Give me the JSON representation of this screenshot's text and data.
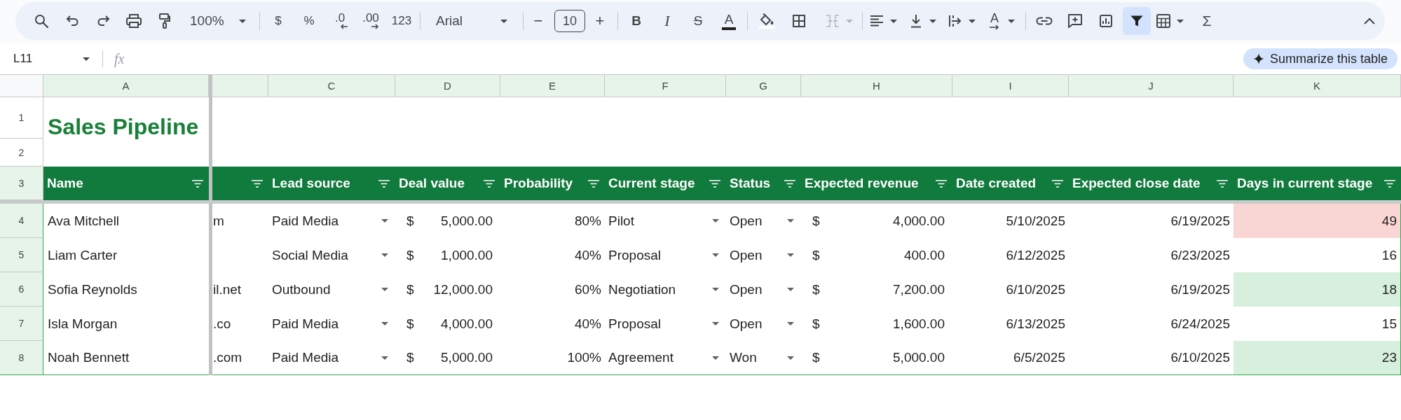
{
  "toolbar": {
    "zoom": "100%",
    "currency": "$",
    "percent": "%",
    "decrease_decimals": ".0",
    "increase_decimals": ".00",
    "number_format": "123",
    "font": "Arial",
    "decrease_font_size": "−",
    "font_size": "10",
    "increase_font_size": "+",
    "bold": "B",
    "italic": "I",
    "strikethrough": "S",
    "text_color": "A",
    "merge_cells": {
      "disabled": true
    },
    "text_rotation": "A",
    "filter": {
      "selected": true
    },
    "functions": "Σ"
  },
  "formula_bar": {
    "cell_reference": "L11",
    "function_label": "fx"
  },
  "summarize_button": {
    "label": "Summarize this table"
  },
  "sheet": {
    "columns": [
      {
        "letter": "A",
        "header": "Name",
        "kind": "text"
      },
      {
        "kind": "clipped"
      },
      {
        "letter": "C",
        "header": "Lead source",
        "kind": "dropdown"
      },
      {
        "letter": "D",
        "header": "Deal value",
        "kind": "currency"
      },
      {
        "letter": "E",
        "header": "Probability",
        "kind": "number"
      },
      {
        "letter": "F",
        "header": "Current stage",
        "kind": "dropdown"
      },
      {
        "letter": "G",
        "header": "Status",
        "kind": "dropdown"
      },
      {
        "letter": "H",
        "header": "Expected revenue",
        "kind": "currency"
      },
      {
        "letter": "I",
        "header": "Date created",
        "kind": "number"
      },
      {
        "letter": "J",
        "header": "Expected close date",
        "kind": "number"
      },
      {
        "letter": "K",
        "header": "Days in current stage",
        "kind": "number"
      }
    ],
    "row_numbers": [
      {
        "label": "1",
        "highlighted": false
      },
      {
        "label": "2",
        "highlighted": false
      },
      {
        "label": "3",
        "highlighted": true
      },
      {
        "label": "4",
        "highlighted": true
      },
      {
        "label": "5",
        "highlighted": true
      },
      {
        "label": "6",
        "highlighted": true
      },
      {
        "label": "7",
        "highlighted": true
      },
      {
        "label": "8",
        "highlighted": true
      }
    ],
    "title": "Sales Pipeline",
    "rows": [
      {
        "cells": [
          {
            "text": "Ava Mitchell"
          },
          {
            "text": "m"
          },
          {
            "text": "Paid Media"
          },
          {
            "currency": "$",
            "text": "5,000.00"
          },
          {
            "text": "80%"
          },
          {
            "text": "Pilot"
          },
          {
            "text": "Open"
          },
          {
            "currency": "$",
            "text": "4,000.00"
          },
          {
            "text": "5/10/2025"
          },
          {
            "text": "6/19/2025"
          },
          {
            "text": "49",
            "color": "#f9d6d3"
          }
        ]
      },
      {
        "cells": [
          {
            "text": "Liam Carter"
          },
          null,
          {
            "text": "Social Media"
          },
          {
            "currency": "$",
            "text": "1,000.00"
          },
          {
            "text": "40%"
          },
          {
            "text": "Proposal"
          },
          {
            "text": "Open"
          },
          {
            "currency": "$",
            "text": "400.00"
          },
          {
            "text": "6/12/2025"
          },
          {
            "text": "6/23/2025"
          },
          {
            "text": "16"
          }
        ]
      },
      {
        "cells": [
          {
            "text": "Sofia Reynolds"
          },
          {
            "text": "il.net"
          },
          {
            "text": "Outbound"
          },
          {
            "currency": "$",
            "text": "12,000.00"
          },
          {
            "text": "60%"
          },
          {
            "text": "Negotiation"
          },
          {
            "text": "Open"
          },
          {
            "currency": "$",
            "text": "7,200.00"
          },
          {
            "text": "6/10/2025"
          },
          {
            "text": "6/19/2025"
          },
          {
            "text": "18",
            "color": "#d6f0dd"
          }
        ]
      },
      {
        "cells": [
          {
            "text": "Isla Morgan"
          },
          {
            "text": ".co"
          },
          {
            "text": "Paid Media"
          },
          {
            "currency": "$",
            "text": "4,000.00"
          },
          {
            "text": "40%"
          },
          {
            "text": "Proposal"
          },
          {
            "text": "Open"
          },
          {
            "currency": "$",
            "text": "1,600.00"
          },
          {
            "text": "6/13/2025"
          },
          {
            "text": "6/24/2025"
          },
          {
            "text": "15"
          }
        ]
      },
      {
        "cells": [
          {
            "text": "Noah Bennett"
          },
          {
            "text": ".com"
          },
          {
            "text": "Paid Media"
          },
          {
            "currency": "$",
            "text": "5,000.00"
          },
          {
            "text": "100%"
          },
          {
            "text": "Agreement"
          },
          {
            "text": "Won"
          },
          {
            "currency": "$",
            "text": "5,000.00"
          },
          {
            "text": "6/5/2025"
          },
          {
            "text": "6/10/2025"
          },
          {
            "text": "23",
            "color": "#d6f0dd"
          }
        ]
      }
    ]
  }
}
